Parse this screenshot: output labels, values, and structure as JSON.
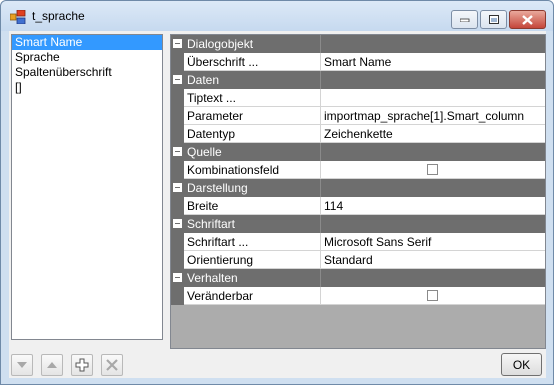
{
  "window": {
    "title": "t_sprache"
  },
  "list": {
    "items": [
      {
        "label": "Smart Name",
        "selected": true
      },
      {
        "label": "Sprache",
        "selected": false
      },
      {
        "label": "Spaltenüberschrift",
        "selected": false
      },
      {
        "label": "[]",
        "selected": false
      }
    ]
  },
  "grid": {
    "categories": [
      {
        "name": "Dialogobjekt",
        "props": [
          {
            "name": "Überschrift ...",
            "value": "Smart Name"
          }
        ]
      },
      {
        "name": "Daten",
        "props": [
          {
            "name": "Tiptext ...",
            "value": ""
          },
          {
            "name": "Parameter",
            "value": "importmap_sprache[1].Smart_column"
          },
          {
            "name": "Datentyp",
            "value": "Zeichenkette"
          }
        ]
      },
      {
        "name": "Quelle",
        "props": [
          {
            "name": "Kombinationsfeld",
            "value": "",
            "checkbox": true,
            "checked": false
          }
        ]
      },
      {
        "name": "Darstellung",
        "props": [
          {
            "name": "Breite",
            "value": "114"
          }
        ]
      },
      {
        "name": "Schriftart",
        "props": [
          {
            "name": "Schriftart ...",
            "value": "Microsoft Sans Serif"
          },
          {
            "name": "Orientierung",
            "value": "Standard"
          }
        ]
      },
      {
        "name": "Verhalten",
        "props": [
          {
            "name": "Veränderbar",
            "value": "",
            "checkbox": true,
            "checked": false
          }
        ]
      }
    ]
  },
  "toolbar": {
    "buttons": [
      {
        "icon": "arrow-down-icon",
        "enabled": false
      },
      {
        "icon": "arrow-up-icon",
        "enabled": false
      },
      {
        "icon": "add-icon",
        "enabled": true
      },
      {
        "icon": "delete-icon",
        "enabled": false
      }
    ],
    "ok_label": "OK"
  },
  "colors": {
    "selection": "#3399ff",
    "category_bar": "#6e6e6e",
    "grid_empty": "#acacac"
  }
}
